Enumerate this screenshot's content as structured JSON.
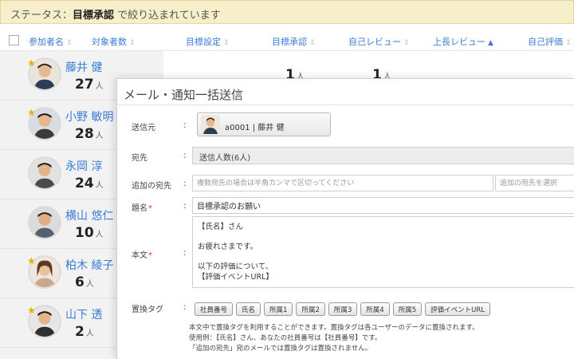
{
  "status": {
    "prefix": "ステータス：",
    "value": "目標承認",
    "suffix": " で絞り込まれています"
  },
  "table": {
    "headers": [
      "参加者名",
      "対象者数",
      "目標設定",
      "目標承認",
      "自己レビュー",
      "上長レビュー",
      "自己評価"
    ],
    "sort_icon": "⇕",
    "active_sort_icon": "▲"
  },
  "participants": [
    {
      "name": "藤井 健",
      "count": "27",
      "unit": "人",
      "approval": "1",
      "self_review": "1",
      "star": true
    },
    {
      "name": "小野 敏明",
      "count": "28",
      "unit": "人",
      "star": true
    },
    {
      "name": "永岡 淳",
      "count": "24",
      "unit": "人",
      "star": false
    },
    {
      "name": "横山 悠仁",
      "count": "10",
      "unit": "人",
      "star": false
    },
    {
      "name": "柏木 綾子",
      "count": "6",
      "unit": "人",
      "star": true
    },
    {
      "name": "山下 透",
      "count": "2",
      "unit": "人",
      "star": true
    }
  ],
  "cell_unit": "人",
  "modal": {
    "title": "メール・通知一括送信",
    "colon": ":",
    "sender": {
      "label": "送信元",
      "value": "a0001 | 藤井 健"
    },
    "recipient": {
      "label": "宛先",
      "value": "送信人数(6人)"
    },
    "cc": {
      "label": "追加の宛先",
      "placeholder": "複数宛先の場合は半角カンマで区切ってください",
      "select_placeholder": "追加の宛先を選択"
    },
    "subject": {
      "label": "題名",
      "required": "*",
      "value": "目標承認のお願い"
    },
    "body": {
      "label": "本文",
      "required": "*",
      "lines": [
        "【氏名】さん",
        "",
        "お疲れさまです。",
        "",
        "以下の評価について、",
        "【評価イベントURL】"
      ]
    },
    "tags": {
      "label": "置換タグ",
      "items": [
        "社員番号",
        "氏名",
        "所属1",
        "所属2",
        "所属3",
        "所属4",
        "所属5",
        "評価イベントURL"
      ]
    },
    "help": [
      "本文中で置換タグを利用することができます。置換タグは各ユーザーのデータに置換されます。",
      "使用例：【氏名】さん、あなたの社員番号は【社員番号】です。",
      "「追加の宛先」宛のメールでは置換タグは置換されません。"
    ]
  },
  "colors": {
    "status_bg": "#f7efc9",
    "link_blue": "#3a7bd5",
    "required_red": "#dd3333",
    "star": "#e6b100"
  },
  "icons": {
    "star": "star-icon",
    "sort": "sort-icon",
    "checkbox": "checkbox-icon"
  }
}
